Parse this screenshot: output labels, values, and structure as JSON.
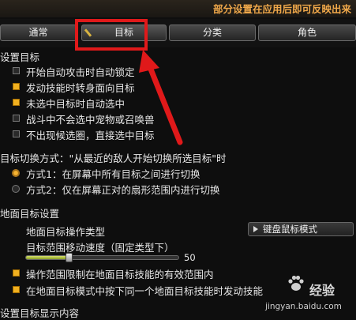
{
  "header": {
    "notice": "部分设置在应用后即可反映出来"
  },
  "tabs": [
    {
      "label": "通常",
      "active": false
    },
    {
      "label": "目标",
      "active": true
    },
    {
      "label": "分类",
      "active": false
    },
    {
      "label": "角色",
      "active": false
    }
  ],
  "target_settings": {
    "title": "设置目标",
    "options": [
      {
        "label": "开始自动攻击时自动锁定",
        "checked": false
      },
      {
        "label": "发动技能时转身面向目标",
        "checked": true
      },
      {
        "label": "未选中目标时自动选中",
        "checked": true
      },
      {
        "label": "战斗中不会选中宠物或召唤兽",
        "checked": false
      },
      {
        "label": "不出现候选圈，直接选中目标",
        "checked": false
      }
    ]
  },
  "switch_mode": {
    "title": "目标切换方式：\"从最近的敌人开始切换所选目标\"时",
    "options": [
      {
        "label": "方式1：在屏幕中所有目标之间进行切换",
        "selected": true
      },
      {
        "label": "方式2：仅在屏幕正对的扇形范围内进行切换",
        "selected": false
      }
    ]
  },
  "ground_target": {
    "title": "地面目标设置",
    "operation_type_label": "地面目标操作类型",
    "operation_type_value": "键盘鼠标模式",
    "speed_label": "目标范围移动速度（固定类型下）",
    "speed_value": "50",
    "speed_fraction": 0.28,
    "options": [
      {
        "label": "操作范围限制在地面目标技能的有效范围内",
        "checked": true
      },
      {
        "label": "在地面目标模式中按下同一个地面目标技能时发动技能",
        "checked": true
      }
    ]
  },
  "display_section": {
    "title": "设置目标显示内容"
  },
  "watermark": {
    "cn": "经验",
    "url": "jingyan.baidu.com"
  },
  "colors": {
    "highlight": "#e0191a",
    "accent": "#f0b020"
  }
}
